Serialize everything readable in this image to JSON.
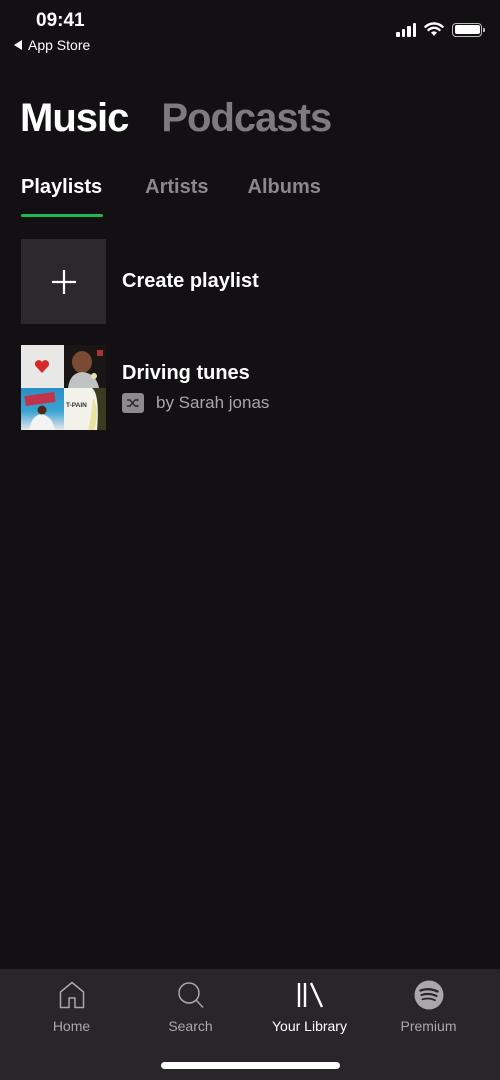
{
  "status_bar": {
    "time": "09:41",
    "back_app_label": "App Store",
    "signal_bars": 4,
    "battery_level": 1.0
  },
  "top_tabs": [
    {
      "label": "Music",
      "active": true
    },
    {
      "label": "Podcasts",
      "active": false
    }
  ],
  "sub_tabs": [
    {
      "label": "Playlists",
      "active": true
    },
    {
      "label": "Artists",
      "active": false
    },
    {
      "label": "Albums",
      "active": false
    }
  ],
  "accent_color": "#1db954",
  "list": {
    "create_playlist": {
      "label": "Create playlist",
      "icon": "plus-icon"
    },
    "playlists": [
      {
        "title": "Driving tunes",
        "subtitle": "by Sarah jonas",
        "badge_icon": "shuffle-icon",
        "cover_text": "T-PAIN"
      }
    ]
  },
  "bottom_nav": [
    {
      "label": "Home",
      "icon": "home-icon",
      "active": false
    },
    {
      "label": "Search",
      "icon": "search-icon",
      "active": false
    },
    {
      "label": "Your Library",
      "icon": "library-icon",
      "active": true
    },
    {
      "label": "Premium",
      "icon": "spotify-logo-icon",
      "active": false
    }
  ]
}
